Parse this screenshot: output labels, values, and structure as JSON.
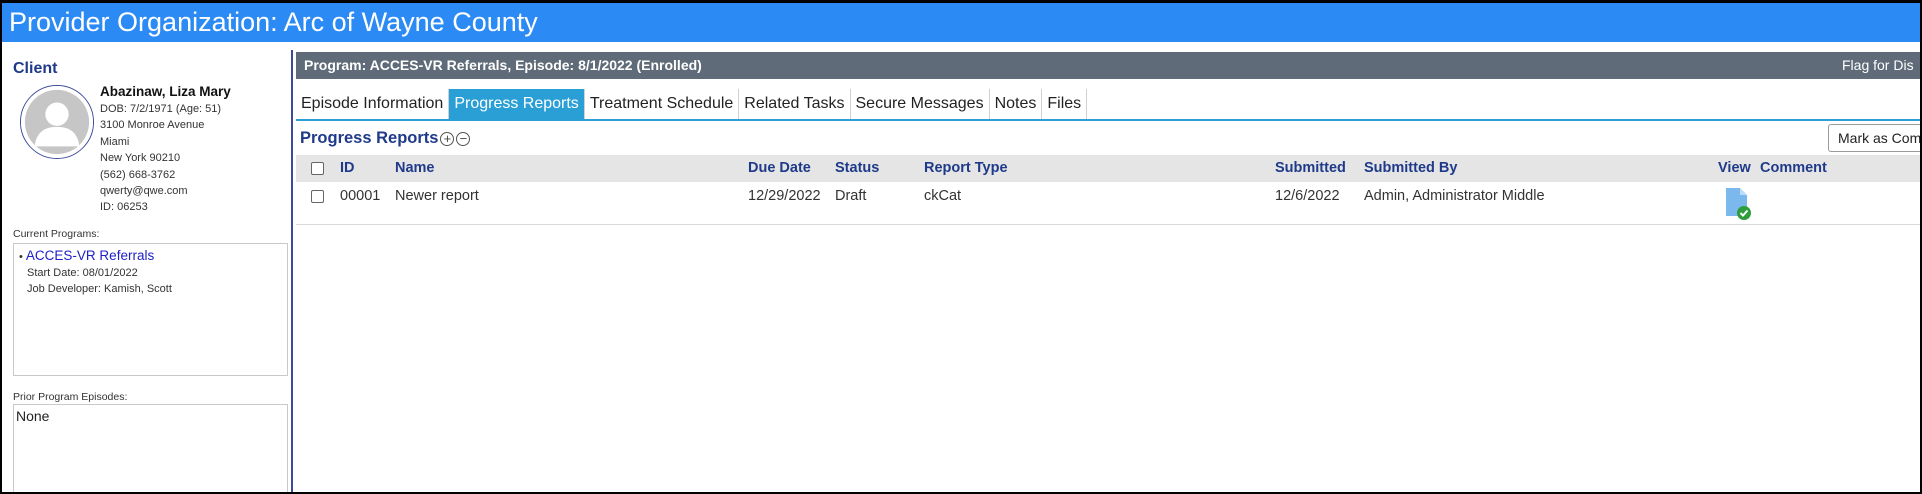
{
  "header": {
    "title": "Provider Organization: Arc of Wayne County"
  },
  "client": {
    "section_label": "Client",
    "name": "Abazinaw, Liza Mary",
    "dob": "DOB: 7/2/1971 (Age: 51)",
    "address1": "3100 Monroe Avenue",
    "city": "Miami",
    "state_zip": "New York 90210",
    "phone": "(562) 668-3762",
    "email": "qwerty@qwe.com",
    "id": "ID: 06253"
  },
  "current_programs": {
    "label": "Current Programs:",
    "items": [
      {
        "bullet": "•",
        "name": "ACCES-VR Referrals",
        "start_date": "Start Date: 08/01/2022",
        "job_developer": "Job Developer: Kamish, Scott"
      }
    ]
  },
  "prior_programs": {
    "label": "Prior Program Episodes:",
    "value": "None"
  },
  "program_bar": {
    "title": "Program: ACCES-VR Referrals, Episode: 8/1/2022 (Enrolled)",
    "flag_label": "Flag for Dis"
  },
  "tabs": [
    {
      "label": "Episode Information",
      "active": false
    },
    {
      "label": "Progress Reports",
      "active": true
    },
    {
      "label": "Treatment Schedule",
      "active": false
    },
    {
      "label": "Related Tasks",
      "active": false
    },
    {
      "label": "Secure Messages",
      "active": false
    },
    {
      "label": "Notes",
      "active": false
    },
    {
      "label": "Files",
      "active": false
    }
  ],
  "section": {
    "title": "Progress Reports",
    "expand_glyph": "+",
    "collapse_glyph": "−",
    "mark_button": "Mark as Com"
  },
  "table": {
    "columns": {
      "id": "ID",
      "name": "Name",
      "due_date": "Due Date",
      "status": "Status",
      "report_type": "Report Type",
      "submitted": "Submitted",
      "submitted_by": "Submitted By",
      "view": "View",
      "comment": "Comment"
    },
    "rows": [
      {
        "id": "00001",
        "name": "Newer report",
        "due_date": "12/29/2022",
        "status": "Draft",
        "report_type": "ckCat",
        "submitted": "12/6/2022",
        "submitted_by": "Admin, Administrator Middle",
        "view_icon": "document-check-icon",
        "comment": ""
      }
    ]
  },
  "colors": {
    "header_blue": "#2b8af3",
    "tab_active": "#2a9fd6",
    "program_bar": "#5f6b78",
    "heading_navy": "#1f3a8a",
    "link_blue": "#2020c8",
    "check_green": "#2e9e3c"
  }
}
